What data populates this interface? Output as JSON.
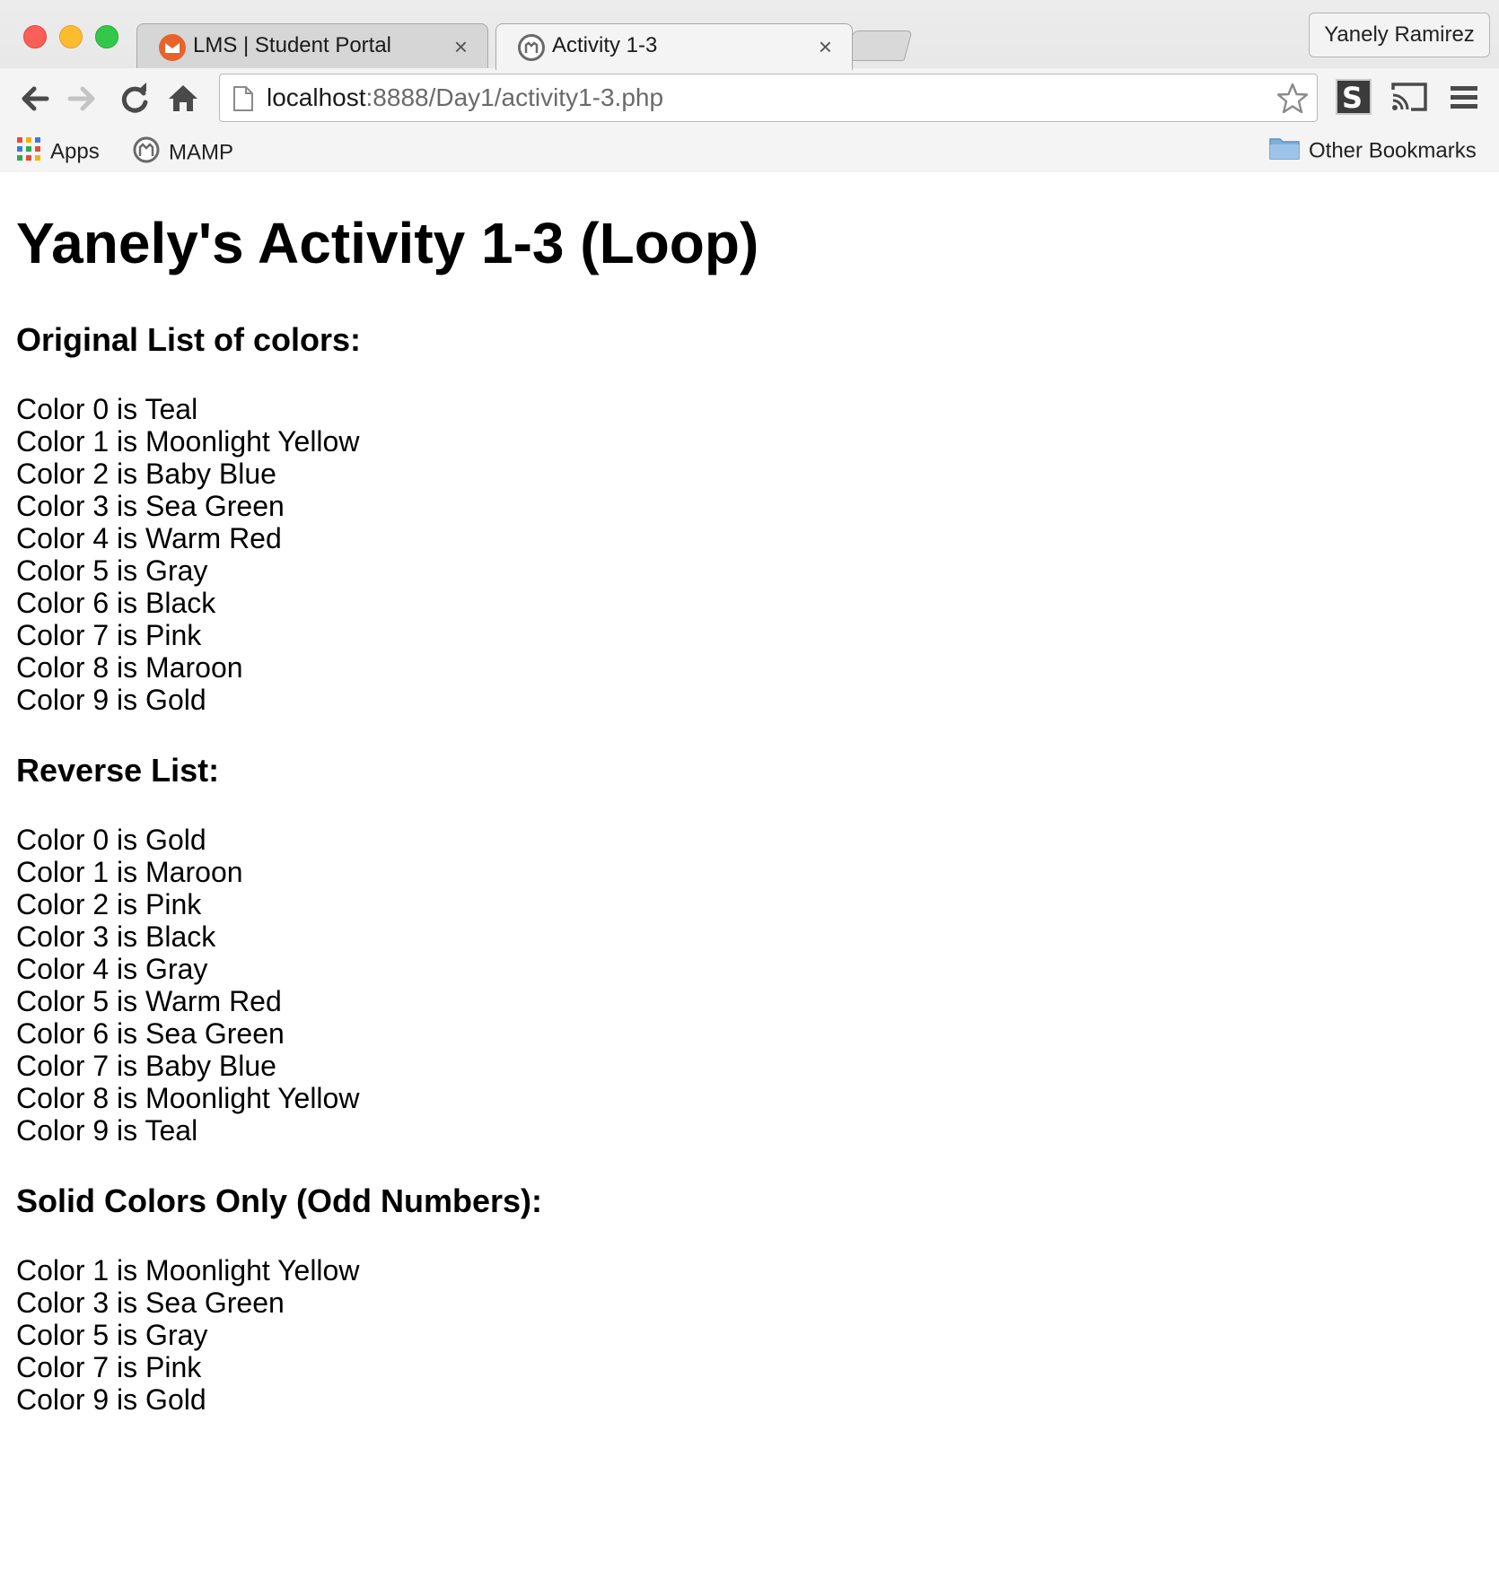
{
  "browser": {
    "tabs": [
      {
        "title": "LMS | Student Portal",
        "close": "×"
      },
      {
        "title": "Activity 1-3",
        "close": "×"
      }
    ],
    "profile_name": "Yanely Ramirez",
    "url_host": "localhost",
    "url_path": ":8888/Day1/activity1-3.php",
    "bookmarks": {
      "apps": "Apps",
      "mamp": "MAMP",
      "other": "Other Bookmarks"
    },
    "icons": [
      "back-icon",
      "forward-icon",
      "reload-icon",
      "home-icon",
      "page-icon",
      "star-icon",
      "extension-icon",
      "cast-icon",
      "menu-icon",
      "apps-grid-icon",
      "mamp-icon",
      "folder-icon"
    ]
  },
  "page": {
    "title": "Yanely's Activity 1-3 (Loop)",
    "sections": [
      {
        "heading": "Original List of colors:",
        "items": [
          "Color 0 is Teal",
          "Color 1 is Moonlight Yellow",
          "Color 2 is Baby Blue",
          "Color 3 is Sea Green",
          "Color 4 is Warm Red",
          "Color 5 is Gray",
          "Color 6 is Black",
          "Color 7 is Pink",
          "Color 8 is Maroon",
          "Color 9 is Gold"
        ]
      },
      {
        "heading": "Reverse List:",
        "items": [
          "Color 0 is Gold",
          "Color 1 is Maroon",
          "Color 2 is Pink",
          "Color 3 is Black",
          "Color 4 is Gray",
          "Color 5 is Warm Red",
          "Color 6 is Sea Green",
          "Color 7 is Baby Blue",
          "Color 8 is Moonlight Yellow",
          "Color 9 is Teal"
        ]
      },
      {
        "heading": "Solid Colors Only (Odd Numbers):",
        "items": [
          "Color 1 is Moonlight Yellow",
          "Color 3 is Sea Green",
          "Color 5 is Gray",
          "Color 7 is Pink",
          "Color 9 is Gold"
        ]
      }
    ]
  }
}
